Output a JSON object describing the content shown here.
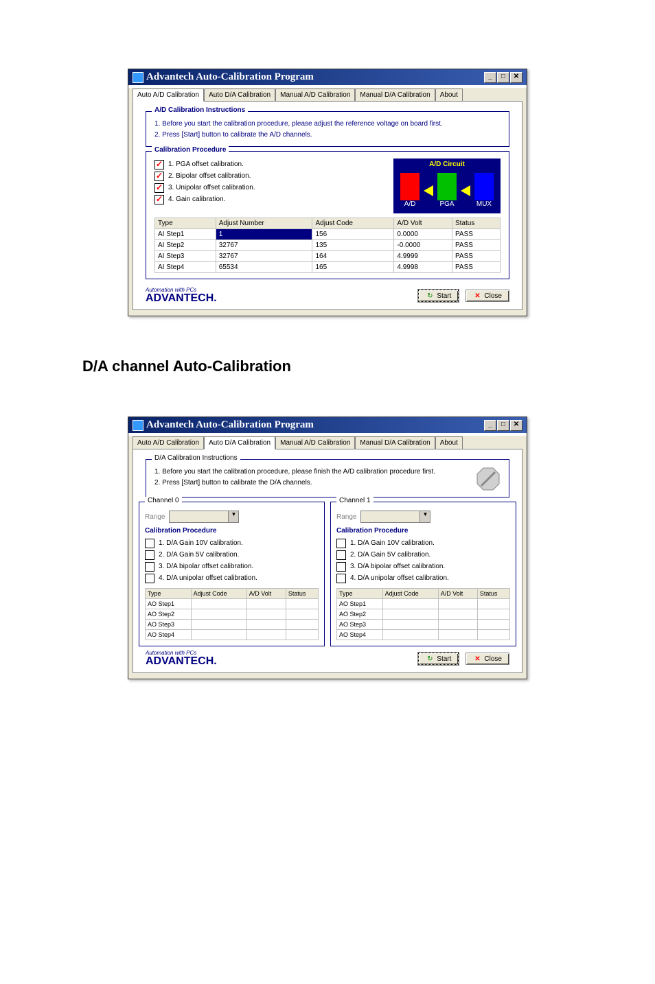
{
  "window1": {
    "title": "Advantech Auto-Calibration Program",
    "tabs": [
      "Auto A/D Calibration",
      "Auto D/A Calibration",
      "Manual A/D Calibration",
      "Manual D/A Calibration",
      "About"
    ],
    "active_tab": 0,
    "instructions_title": "A/D Calibration Instructions",
    "instructions": [
      "1. Before you start the calibration procedure, please adjust the reference voltage on board first.",
      "2. Press [Start] button to calibrate the A/D channels."
    ],
    "procedure_title": "Calibration Procedure",
    "steps": [
      "1. PGA offset calibration.",
      "2. Bipolar offset calibration.",
      "3. Unipolar offset calibration.",
      "4. Gain calibration."
    ],
    "circuit_title": "A/D Circuit",
    "blocks": [
      "A/D",
      "PGA",
      "MUX"
    ],
    "table": {
      "headers": [
        "Type",
        "Adjust Number",
        "Adjust Code",
        "A/D Volt",
        "Status"
      ],
      "rows": [
        [
          "AI Step1",
          "1",
          "156",
          "0.0000",
          "PASS"
        ],
        [
          "AI Step2",
          "32767",
          "135",
          "-0.0000",
          "PASS"
        ],
        [
          "AI Step3",
          "32767",
          "164",
          "4.9999",
          "PASS"
        ],
        [
          "AI Step4",
          "65534",
          "165",
          "4.9998",
          "PASS"
        ]
      ]
    },
    "logo_small": "Automation with PCs",
    "logo_big": "ADVANTECH.",
    "start": "Start",
    "close": "Close"
  },
  "heading": "D/A channel Auto-Calibration",
  "window2": {
    "title": "Advantech Auto-Calibration Program",
    "tabs": [
      "Auto A/D Calibration",
      "Auto D/A Calibration",
      "Manual A/D Calibration",
      "Manual D/A Calibration",
      "About"
    ],
    "active_tab": 1,
    "instructions_title": "D/A Calibration Instructions",
    "instructions": [
      "1. Before you start the calibration procedure, please finish the A/D calibration procedure first.",
      "2. Press [Start] button to calibrate the D/A channels."
    ],
    "channel0_title": "Channel 0",
    "channel1_title": "Channel 1",
    "range_label": "Range",
    "procedure_title": "Calibration Procedure",
    "steps": [
      "1. D/A Gain 10V calibration.",
      "2. D/A Gain 5V calibration.",
      "3. D/A bipolar offset calibration.",
      "4. D/A unipolar offset calibration."
    ],
    "table": {
      "headers": [
        "Type",
        "Adjust Code",
        "A/D Volt",
        "Status"
      ],
      "rows": [
        "AO Step1",
        "AO Step2",
        "AO Step3",
        "AO Step4"
      ]
    },
    "logo_small": "Automation with PCs",
    "logo_big": "ADVANTECH.",
    "start": "Start",
    "close": "Close"
  }
}
